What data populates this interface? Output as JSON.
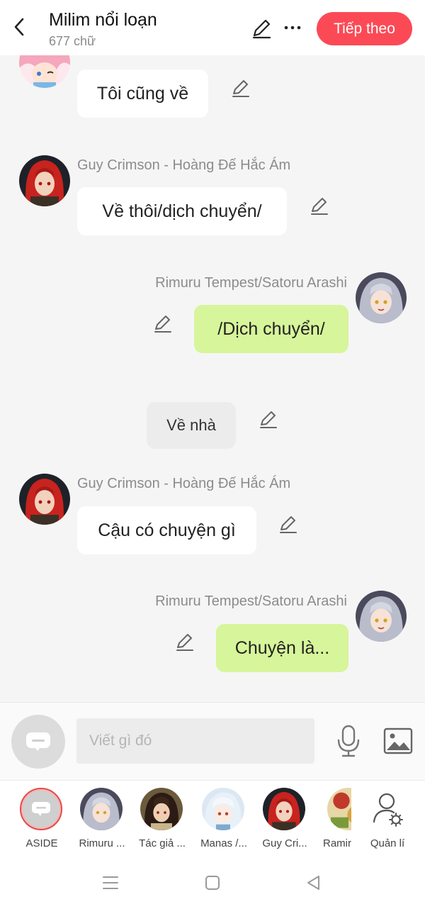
{
  "header": {
    "title": "Milim nổi loạn",
    "word_count": "677 chữ",
    "next_label": "Tiếp theo",
    "accent": "#fb4a56"
  },
  "messages": [
    {
      "type": "left",
      "sender": "",
      "text": "Tôi cũng về",
      "avatar": "pink-hair-avatar"
    },
    {
      "type": "left",
      "sender": "Guy Crimson - Hoàng Đế Hắc Ám",
      "text": "Về thôi/dịch chuyển/",
      "avatar": "red-hair-avatar"
    },
    {
      "type": "right",
      "sender": "Rimuru Tempest/Satoru Arashi",
      "text": "/Dịch chuyển/",
      "avatar": "silver-hair-avatar"
    },
    {
      "type": "narration",
      "sender": "",
      "text": "Về nhà"
    },
    {
      "type": "left",
      "sender": "Guy Crimson - Hoàng Đế Hắc Ám",
      "text": "Cậu có chuyện gì",
      "avatar": "red-hair-avatar"
    },
    {
      "type": "right",
      "sender": "Rimuru Tempest/Satoru Arashi",
      "text": "Chuyện là...",
      "avatar": "silver-hair-avatar"
    }
  ],
  "input": {
    "placeholder": "Viết gì đó"
  },
  "characters": [
    {
      "name": "ASIDE",
      "icon": "aside-icon"
    },
    {
      "name": "Rimuru ...",
      "icon": "silver-hair-avatar"
    },
    {
      "name": "Tác giả ...",
      "icon": "dark-hair-avatar"
    },
    {
      "name": "Manas /...",
      "icon": "white-hair-avatar"
    },
    {
      "name": "Guy Cri...",
      "icon": "red-hair-avatar"
    },
    {
      "name": "Ramir",
      "icon": "food-avatar"
    },
    {
      "name": "Quản lí",
      "icon": "manage-user-icon"
    }
  ],
  "colors": {
    "bubble_right": "#d7f59a",
    "bubble_left": "#ffffff",
    "background": "#f5f5f5"
  }
}
